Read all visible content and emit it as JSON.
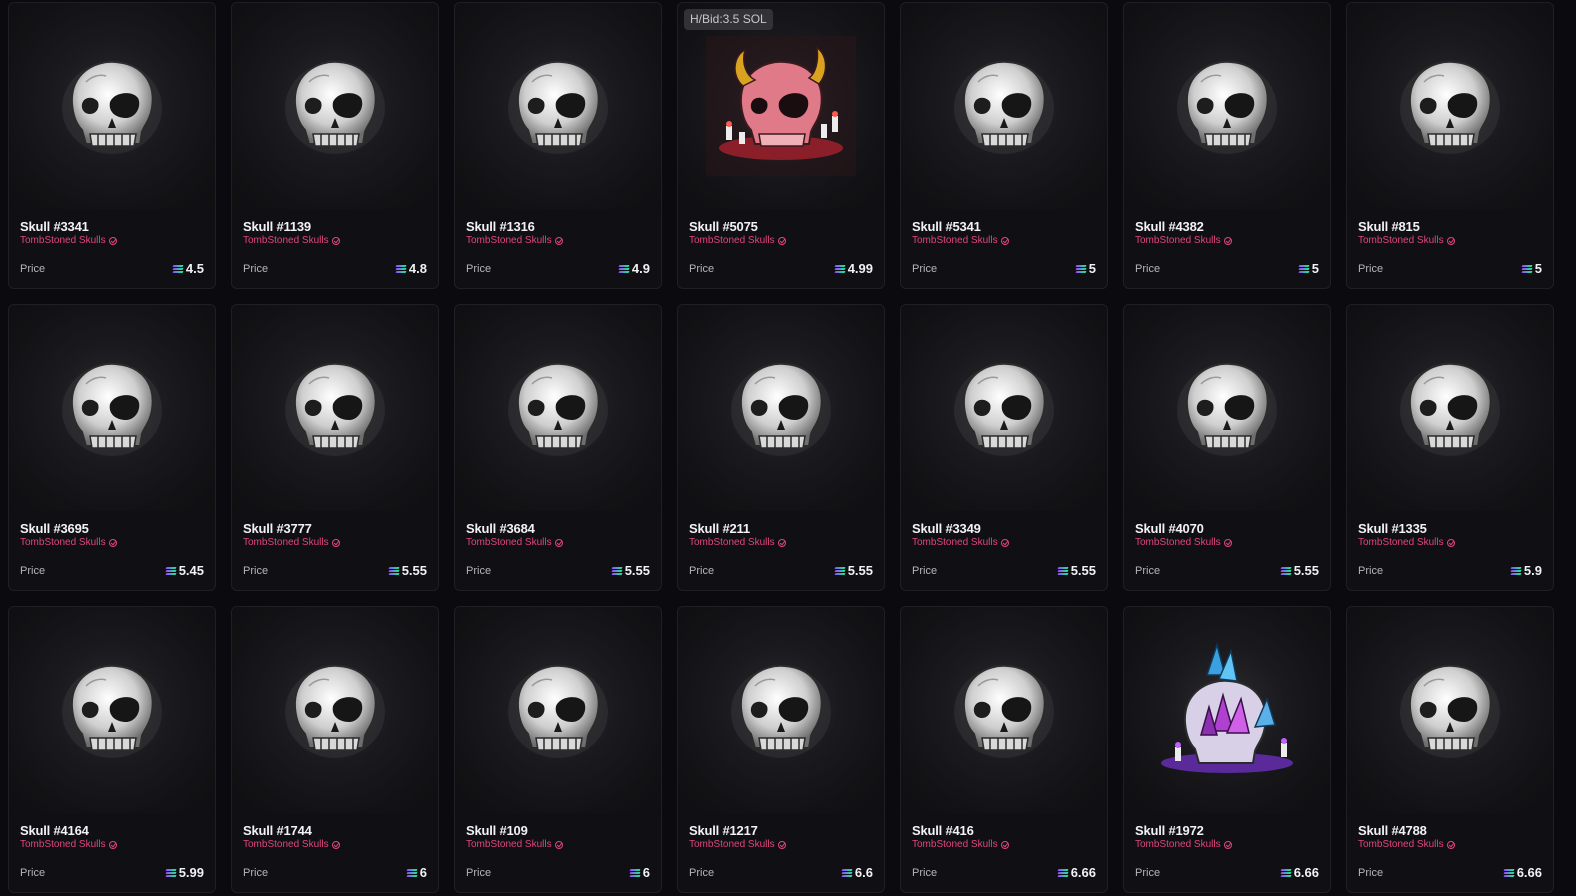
{
  "colors": {
    "background": "#0b0b0f",
    "card": "#101014",
    "collection_pink": "#e0457e",
    "text": "#f2f2f4"
  },
  "labels": {
    "price": "Price"
  },
  "cards": [
    {
      "name": "Skull #3341",
      "collection": "TombStoned Skulls",
      "price": "4.5",
      "art": "skull-plain"
    },
    {
      "name": "Skull #1139",
      "collection": "TombStoned Skulls",
      "price": "4.8",
      "art": "skull-plain"
    },
    {
      "name": "Skull #1316",
      "collection": "TombStoned Skulls",
      "price": "4.9",
      "art": "skull-plain"
    },
    {
      "name": "Skull #5075",
      "collection": "TombStoned Skulls",
      "price": "4.99",
      "art": "skull-demon",
      "badge": "H/Bid:3.5 SOL"
    },
    {
      "name": "Skull #5341",
      "collection": "TombStoned Skulls",
      "price": "5",
      "art": "skull-plain"
    },
    {
      "name": "Skull #4382",
      "collection": "TombStoned Skulls",
      "price": "5",
      "art": "skull-plain"
    },
    {
      "name": "Skull #815",
      "collection": "TombStoned Skulls",
      "price": "5",
      "art": "skull-plain"
    },
    {
      "name": "Skull #3695",
      "collection": "TombStoned Skulls",
      "price": "5.45",
      "art": "skull-plain"
    },
    {
      "name": "Skull #3777",
      "collection": "TombStoned Skulls",
      "price": "5.55",
      "art": "skull-plain"
    },
    {
      "name": "Skull #3684",
      "collection": "TombStoned Skulls",
      "price": "5.55",
      "art": "skull-plain"
    },
    {
      "name": "Skull #211",
      "collection": "TombStoned Skulls",
      "price": "5.55",
      "art": "skull-plain"
    },
    {
      "name": "Skull #3349",
      "collection": "TombStoned Skulls",
      "price": "5.55",
      "art": "skull-plain"
    },
    {
      "name": "Skull #4070",
      "collection": "TombStoned Skulls",
      "price": "5.55",
      "art": "skull-plain"
    },
    {
      "name": "Skull #1335",
      "collection": "TombStoned Skulls",
      "price": "5.9",
      "art": "skull-plain"
    },
    {
      "name": "Skull #4164",
      "collection": "TombStoned Skulls",
      "price": "5.99",
      "art": "skull-plain"
    },
    {
      "name": "Skull #1744",
      "collection": "TombStoned Skulls",
      "price": "6",
      "art": "skull-plain"
    },
    {
      "name": "Skull #109",
      "collection": "TombStoned Skulls",
      "price": "6",
      "art": "skull-plain"
    },
    {
      "name": "Skull #1217",
      "collection": "TombStoned Skulls",
      "price": "6.6",
      "art": "skull-plain"
    },
    {
      "name": "Skull #416",
      "collection": "TombStoned Skulls",
      "price": "6.66",
      "art": "skull-plain"
    },
    {
      "name": "Skull #1972",
      "collection": "TombStoned Skulls",
      "price": "6.66",
      "art": "skull-crystal"
    },
    {
      "name": "Skull #4788",
      "collection": "TombStoned Skulls",
      "price": "6.66",
      "art": "skull-plain"
    }
  ]
}
